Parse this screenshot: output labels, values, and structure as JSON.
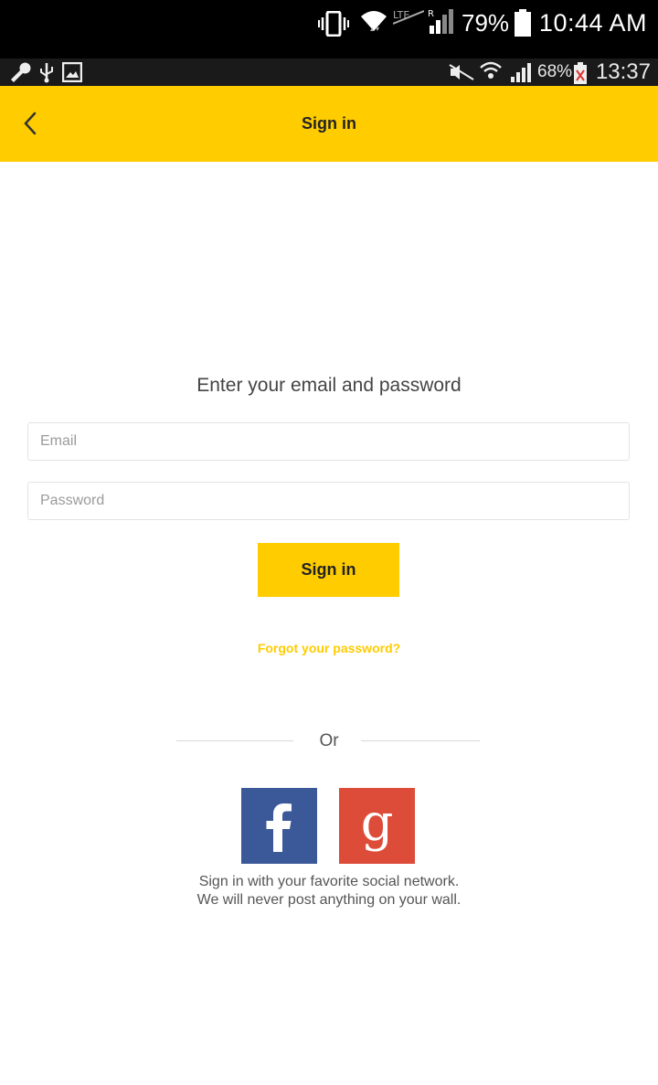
{
  "status_bar": {
    "battery_percent": "79%",
    "time": "10:44 AM",
    "icons": [
      "vibrate-icon",
      "wifi-icon",
      "data-transfer-icon",
      "signal-icon",
      "battery-icon"
    ]
  },
  "inner_status_bar": {
    "battery_percent": "68%",
    "time": "13:37",
    "icons": [
      "wrench-icon",
      "usb-icon",
      "image-icon",
      "mute-icon",
      "wifi-icon",
      "signal-icon",
      "battery-icon"
    ]
  },
  "app_bar": {
    "title": "Sign in",
    "back_icon": "chevron-left-icon",
    "color": "#ffcc00"
  },
  "form": {
    "heading": "Enter your email and password",
    "email_placeholder": "Email",
    "email_value": "",
    "password_placeholder": "Password",
    "password_value": "",
    "submit_label": "Sign in",
    "forgot_label": "Forgot your password?"
  },
  "social": {
    "divider_label": "Or",
    "facebook_icon": "facebook-icon",
    "google_icon": "google-icon",
    "facebook_color": "#3b5998",
    "google_color": "#dd4b39",
    "note_line1": "Sign in with your favorite social network.",
    "note_line2": "We will never post anything on your wall."
  }
}
